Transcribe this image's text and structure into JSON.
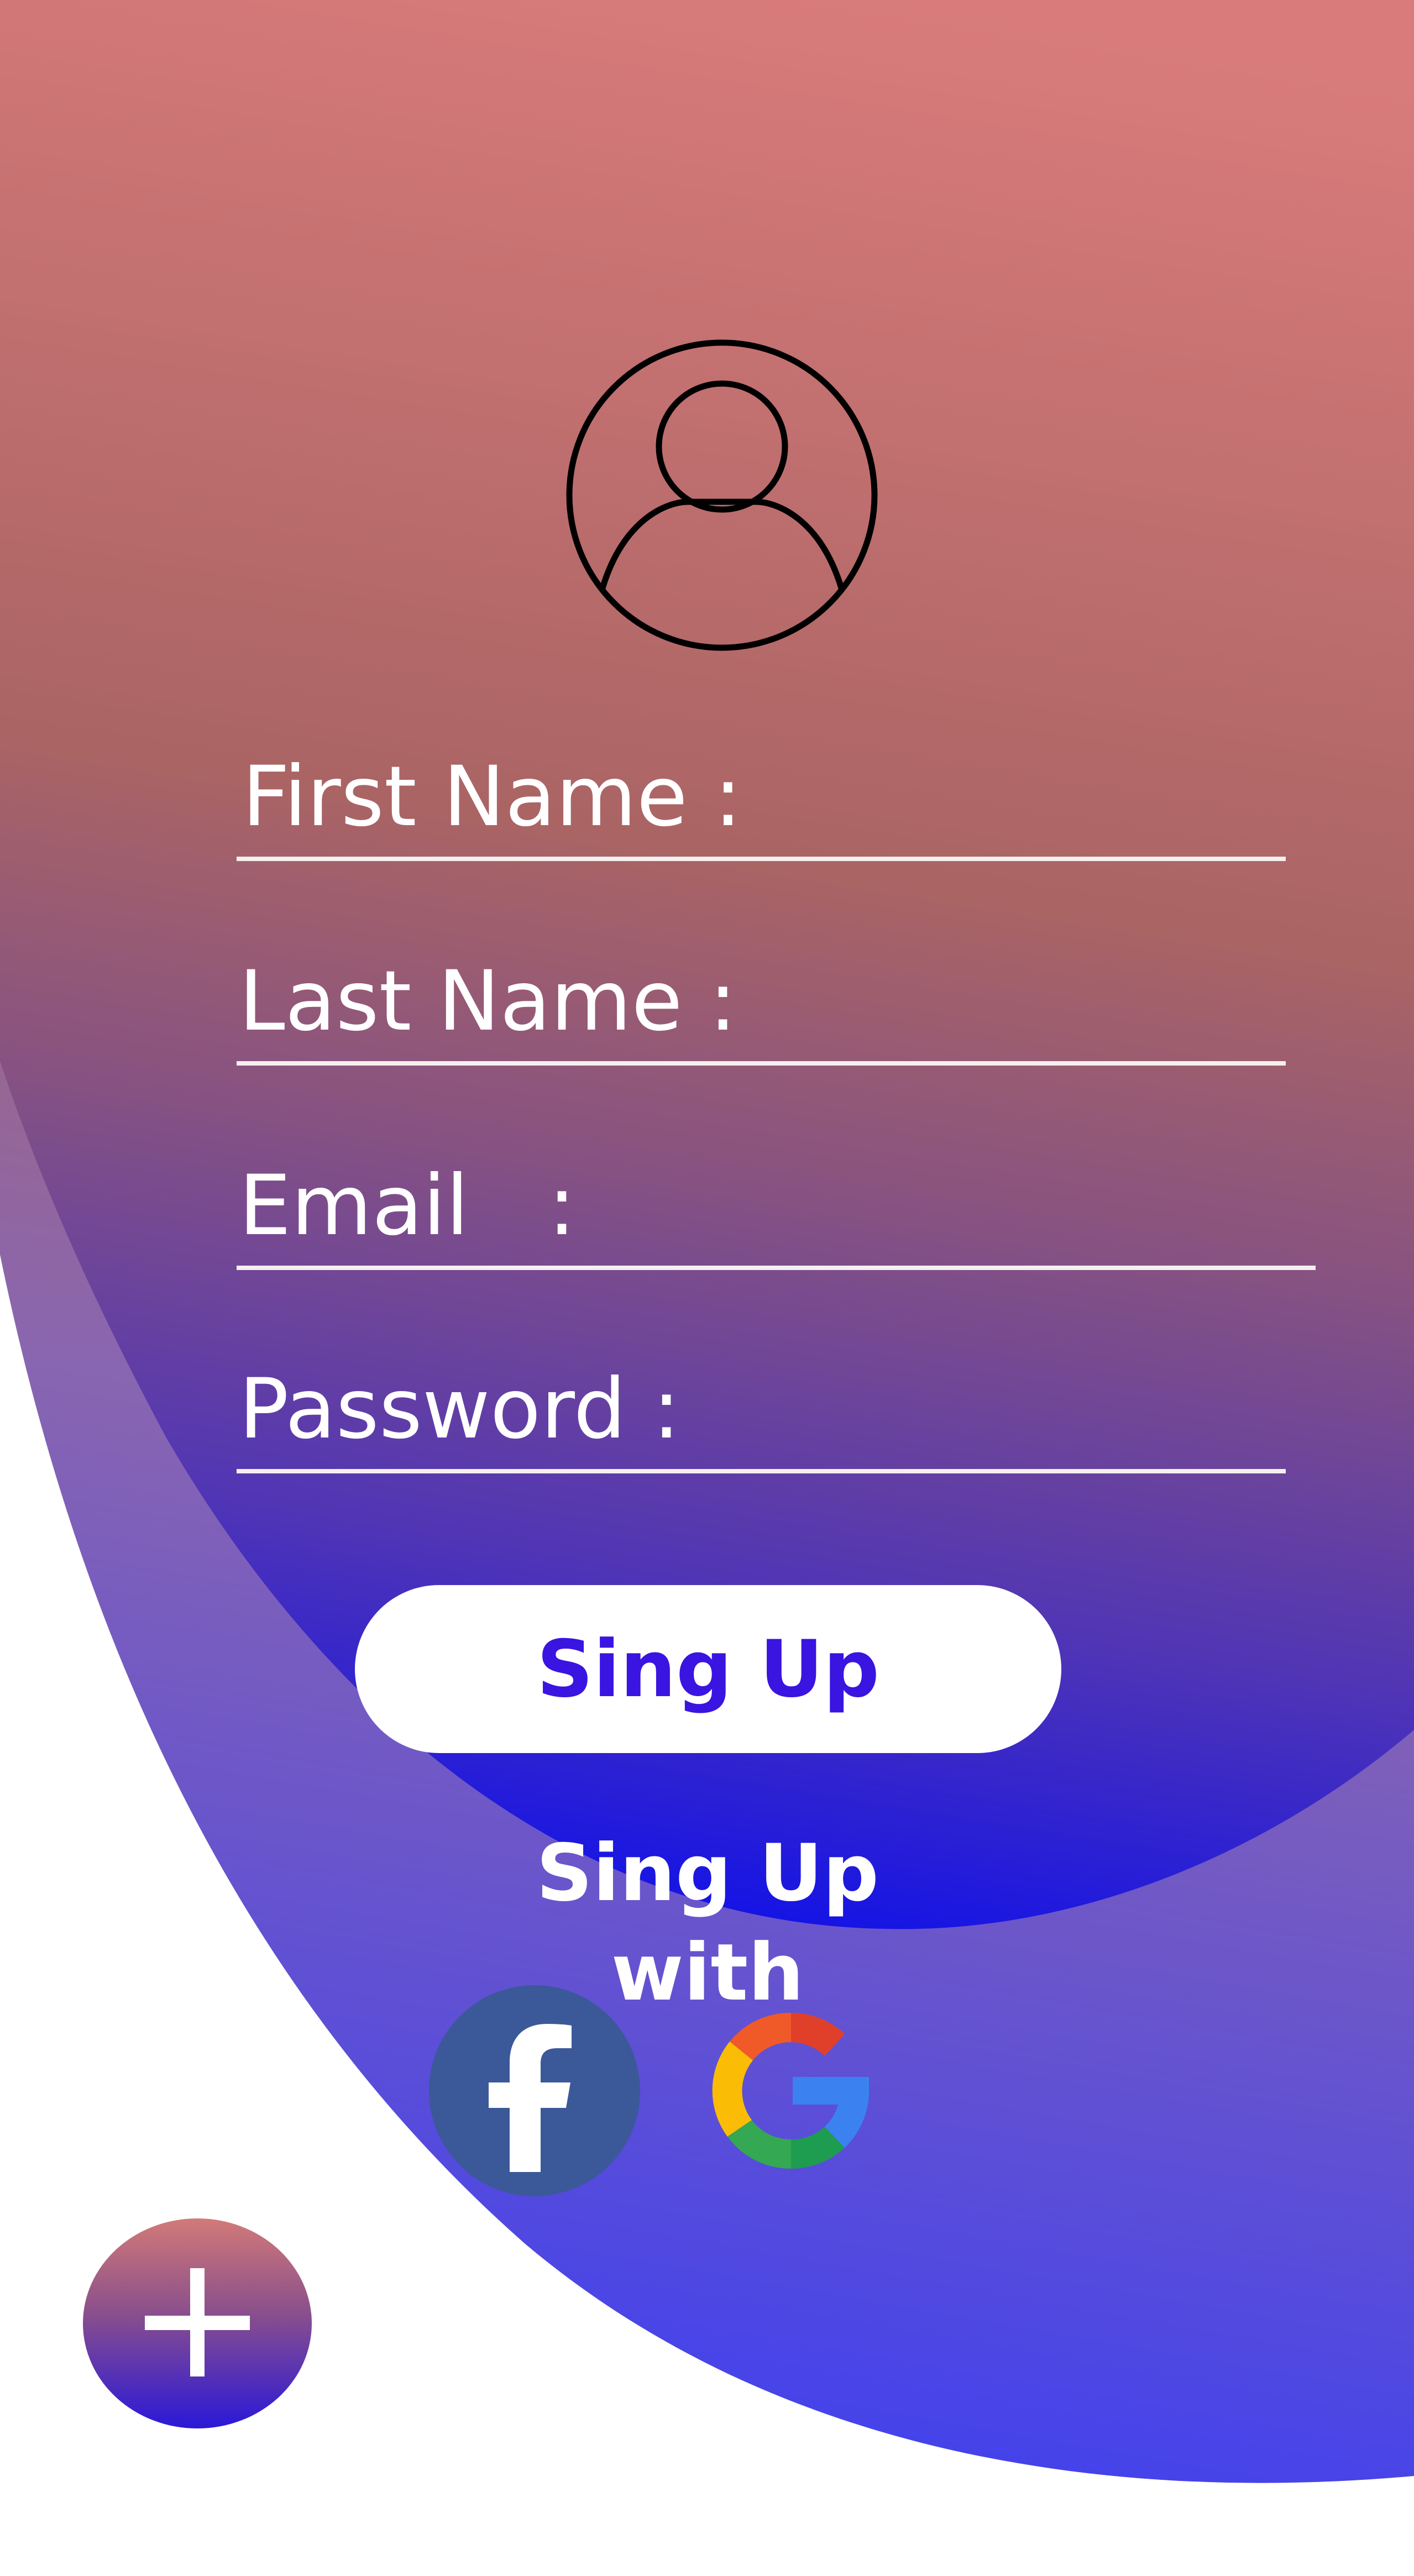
{
  "form": {
    "first_name_label": "First Name :",
    "last_name_label": "Last Name :",
    "email_label": "Email   :",
    "password_label": "Password :"
  },
  "actions": {
    "signup_label": "Sing Up",
    "signup_with_label": "Sing Up with"
  },
  "social": [
    "facebook-icon",
    "google-icon"
  ],
  "icons": {
    "avatar": "user-circle-icon",
    "fab": "plus-icon"
  },
  "colors": {
    "gradient_top": "#d97b7b",
    "gradient_mid": "#aa6464",
    "gradient_bottom": "#1212e8",
    "button_text": "#3a14e0",
    "facebook": "#3b5998"
  }
}
